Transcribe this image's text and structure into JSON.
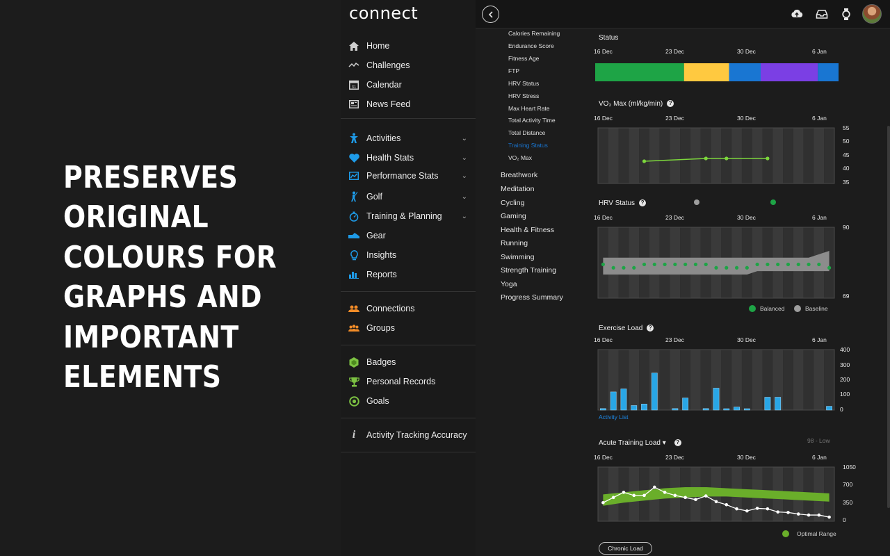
{
  "promo": {
    "lines": [
      "PRESERVES",
      "ORIGINAL",
      "COLOURS FOR",
      "GRAPHS AND",
      "IMPORTANT",
      "ELEMENTS"
    ]
  },
  "app": {
    "logo": "connect"
  },
  "sidebar": {
    "items": [
      {
        "label": "Home",
        "icon": "home-icon",
        "color": "#cfcfcf"
      },
      {
        "label": "Challenges",
        "icon": "challenges-icon",
        "color": "#cfcfcf"
      },
      {
        "label": "Calendar",
        "icon": "calendar-icon",
        "color": "#cfcfcf"
      },
      {
        "label": "News Feed",
        "icon": "newsfeed-icon",
        "color": "#cfcfcf"
      },
      {
        "label": "Activities",
        "icon": "activities-icon",
        "color": "#1e9be8",
        "chevron": true
      },
      {
        "label": "Health Stats",
        "icon": "heart-icon",
        "color": "#1e9be8",
        "chevron": true
      },
      {
        "label": "Performance Stats",
        "icon": "performance-icon",
        "color": "#1e9be8",
        "chevron": true
      },
      {
        "label": "Golf",
        "icon": "golf-icon",
        "color": "#1e9be8",
        "chevron": true
      },
      {
        "label": "Training & Planning",
        "icon": "stopwatch-icon",
        "color": "#1e9be8",
        "chevron": true
      },
      {
        "label": "Gear",
        "icon": "shoe-icon",
        "color": "#1e9be8"
      },
      {
        "label": "Insights",
        "icon": "lightbulb-icon",
        "color": "#1e9be8"
      },
      {
        "label": "Reports",
        "icon": "reports-icon",
        "color": "#1e9be8"
      },
      {
        "label": "Connections",
        "icon": "connections-icon",
        "color": "#f28c28"
      },
      {
        "label": "Groups",
        "icon": "groups-icon",
        "color": "#f28c28"
      },
      {
        "label": "Badges",
        "icon": "badge-icon",
        "color": "#7cc142"
      },
      {
        "label": "Personal Records",
        "icon": "trophy-icon",
        "color": "#7cc142"
      },
      {
        "label": "Goals",
        "icon": "goal-icon",
        "color": "#7cc142"
      },
      {
        "label": "Activity Tracking Accuracy",
        "icon": "info-icon",
        "color": "#cfcfcf"
      }
    ]
  },
  "reports_menu": {
    "sub_items": [
      "Calories Remaining",
      "Endurance Score",
      "Fitness Age",
      "FTP",
      "HRV Status",
      "HRV Stress",
      "Max Heart Rate",
      "Total Activity Time",
      "Total Distance",
      "Training Status",
      "VO₂ Max"
    ],
    "active_sub": "Training Status",
    "categories": [
      "Breathwork",
      "Meditation",
      "Cycling",
      "Gaming",
      "Health & Fitness",
      "Running",
      "Swimming",
      "Strength Training",
      "Yoga",
      "Progress Summary"
    ]
  },
  "dates": [
    "16 Dec",
    "23 Dec",
    "30 Dec",
    "6 Jan"
  ],
  "colors": {
    "productive": "#1ea446",
    "maintaining": "#ffc940",
    "recovery": "#1976d2",
    "peaking": "#7b3fe4",
    "vo2_line": "#7cd63c",
    "hrv_dot": "#1ea446",
    "hrv_band": "#8c8c8c",
    "exercise_bar": "#29a6e6",
    "optimal_range": "#6aae2a",
    "acute_line": "#ffffff"
  },
  "panels": {
    "status": {
      "title": "Status"
    },
    "vo2": {
      "title": "VO₂ Max (ml/kg/min)"
    },
    "hrv": {
      "title": "HRV Status",
      "legend_balanced": "Balanced",
      "legend_baseline": "Baseline"
    },
    "exercise": {
      "title": "Exercise Load",
      "link": "Activity List"
    },
    "acute": {
      "title": "Acute Training Load ▾",
      "level": "98 - Low",
      "legend": "Optimal Range",
      "button": "Chronic Load"
    }
  },
  "chart_data": [
    {
      "type": "bar",
      "title": "Status",
      "note": "Horizontal training-status timeline; segment spans as fraction of 16 Dec – 8 Jan range",
      "segments": [
        {
          "status": "productive",
          "from": 0.0,
          "to": 0.365
        },
        {
          "status": "maintaining",
          "from": 0.365,
          "to": 0.55
        },
        {
          "status": "recovery",
          "from": 0.55,
          "to": 0.68
        },
        {
          "status": "peaking",
          "from": 0.68,
          "to": 0.915
        },
        {
          "status": "recovery",
          "from": 0.915,
          "to": 1.0
        }
      ]
    },
    {
      "type": "line",
      "title": "VO₂ Max (ml/kg/min)",
      "x_days": [
        4,
        10,
        12,
        16
      ],
      "values": [
        43,
        44,
        44,
        44
      ],
      "ylim": [
        35,
        55
      ],
      "y_ticks": [
        "55",
        "50",
        "45",
        "40",
        "35"
      ]
    },
    {
      "type": "scatter",
      "title": "HRV Status",
      "x_days": [
        0,
        1,
        2,
        3,
        4,
        5,
        6,
        7,
        8,
        9,
        10,
        11,
        12,
        13,
        14,
        15,
        16,
        17,
        18,
        19,
        20,
        21,
        22
      ],
      "values": [
        79,
        78,
        78,
        78,
        79,
        79,
        79,
        79,
        79,
        79,
        79,
        78,
        78,
        78,
        78,
        79,
        79,
        79,
        79,
        79,
        79,
        79,
        78
      ],
      "baseline_low": [
        76,
        76,
        76,
        76,
        76,
        76,
        76,
        76,
        76,
        76,
        76,
        76,
        76,
        76,
        76,
        77,
        77,
        77,
        77,
        77,
        77,
        77,
        77
      ],
      "baseline_high": [
        81,
        81,
        81,
        81,
        81,
        81,
        81,
        81,
        81,
        81,
        81,
        81,
        81,
        81,
        81,
        81,
        81,
        81,
        81,
        81,
        81,
        82,
        83
      ],
      "ylim": [
        69,
        90
      ],
      "y_ticks": [
        "90",
        "69"
      ]
    },
    {
      "type": "bar",
      "title": "Exercise Load",
      "x_days": [
        0,
        1,
        2,
        3,
        4,
        5,
        7,
        8,
        10,
        11,
        12,
        13,
        14,
        16,
        17,
        22
      ],
      "values": [
        10,
        120,
        140,
        30,
        40,
        245,
        10,
        80,
        10,
        145,
        0,
        20,
        0,
        85,
        85,
        25
      ],
      "ylim": [
        0,
        400
      ],
      "y_ticks": [
        "400",
        "300",
        "200",
        "100",
        "0"
      ]
    },
    {
      "type": "line",
      "title": "Acute Training Load",
      "x_days": [
        0,
        1,
        2,
        3,
        4,
        5,
        6,
        7,
        8,
        9,
        10,
        11,
        12,
        13,
        14,
        15,
        16,
        17,
        18,
        19,
        20,
        21,
        22
      ],
      "values": [
        360,
        460,
        560,
        500,
        500,
        660,
        560,
        500,
        460,
        420,
        490,
        380,
        320,
        240,
        200,
        250,
        240,
        180,
        170,
        140,
        120,
        120,
        80
      ],
      "optimal_low": [
        300,
        330,
        360,
        380,
        400,
        420,
        440,
        450,
        460,
        470,
        480,
        480,
        480,
        470,
        460,
        450,
        440,
        430,
        420,
        410,
        400,
        390,
        380
      ],
      "optimal_high": [
        520,
        540,
        560,
        580,
        600,
        620,
        640,
        650,
        660,
        660,
        660,
        650,
        640,
        630,
        620,
        610,
        600,
        590,
        580,
        570,
        560,
        550,
        540
      ],
      "ylim": [
        0,
        1050
      ],
      "y_ticks": [
        "1050",
        "700",
        "350",
        "0"
      ]
    }
  ]
}
